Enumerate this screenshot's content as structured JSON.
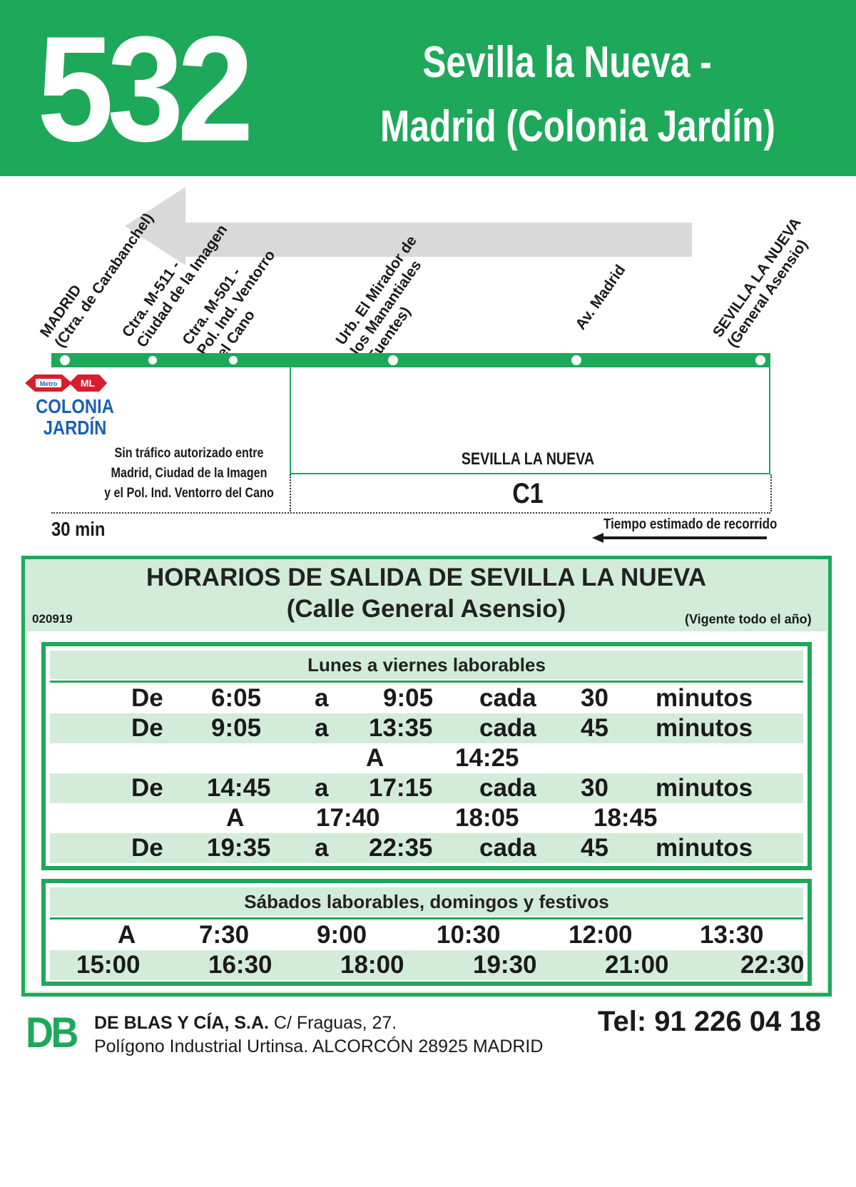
{
  "header": {
    "route_number": "532",
    "route_line1": "Sevilla la Nueva -",
    "route_line2": "Madrid (Colonia Jardín)"
  },
  "diagram": {
    "stops": [
      {
        "label": "MADRID\n(Ctra. de Carabanchel)"
      },
      {
        "label": "Ctra. M-511 -\nCiudad de la Imagen"
      },
      {
        "label": "Ctra. M-501 -\nPol. Ind. Ventorro\ndel Cano"
      },
      {
        "label": "Urb. El Mirador de\nlos Manantiales\n(Fuentes)"
      },
      {
        "label": "Av. Madrid"
      },
      {
        "label": "SEVILLA LA NUEVA\n(General Asensio)"
      }
    ],
    "metro_logo": "Metro",
    "ml_logo": "ML",
    "colonia_line1": "COLONIA",
    "colonia_line2": "JARDÍN",
    "notice_line1": "Sin tráfico autorizado entre",
    "notice_line2": "Madrid, Ciudad de la Imagen",
    "notice_line3": "y el Pol. Ind. Ventorro del Cano",
    "zone_town": "SEVILLA LA NUEVA",
    "zone_code": "C1",
    "travel_time": "30 min",
    "time_estimate_label": "Tiempo estimado de recorrido"
  },
  "schedule": {
    "title": "HORARIOS DE SALIDA DE SEVILLA LA NUEVA",
    "subtitle": "(Calle General Asensio)",
    "code": "020919",
    "validity": "(Vigente todo el año)",
    "weekday": {
      "heading": "Lunes a viernes laborables",
      "rows": [
        {
          "type": "range",
          "de": "De",
          "from": "6:05",
          "a": "a",
          "to": "9:05",
          "cada": "cada",
          "every": "30",
          "unit": "minutos"
        },
        {
          "type": "range",
          "de": "De",
          "from": "9:05",
          "a": "a",
          "to": "13:35",
          "cada": "cada",
          "every": "45",
          "unit": "minutos"
        },
        {
          "type": "single",
          "a": "A",
          "time": "14:25"
        },
        {
          "type": "range",
          "de": "De",
          "from": "14:45",
          "a": "a",
          "to": "17:15",
          "cada": "cada",
          "every": "30",
          "unit": "minutos"
        },
        {
          "type": "multi",
          "a": "A",
          "t1": "17:40",
          "t2": "18:05",
          "t3": "18:45"
        },
        {
          "type": "range",
          "de": "De",
          "from": "19:35",
          "a": "a",
          "to": "22:35",
          "cada": "cada",
          "every": "45",
          "unit": "minutos"
        }
      ]
    },
    "weekend": {
      "heading": "Sábados laborables, domingos y festivos",
      "row1": {
        "a": "A",
        "times": [
          "7:30",
          "9:00",
          "10:30",
          "12:00",
          "13:30"
        ]
      },
      "row2": {
        "times": [
          "15:00",
          "16:30",
          "18:00",
          "19:30",
          "21:00",
          "22:30"
        ]
      }
    }
  },
  "footer": {
    "logo": "DB",
    "company_name": "DE BLAS Y CÍA, S.A.",
    "street": " C/ Fraguas, 27.",
    "address": "Polígono Industrial Urtinsa. ALCORCÓN 28925 MADRID",
    "phone": "Tel: 91 226 04 18"
  },
  "colors": {
    "brand_green": "#1ea85a",
    "light_green": "#d3ecd9",
    "metro_red": "#d81e2c",
    "metro_blue": "#1a5fb4"
  }
}
